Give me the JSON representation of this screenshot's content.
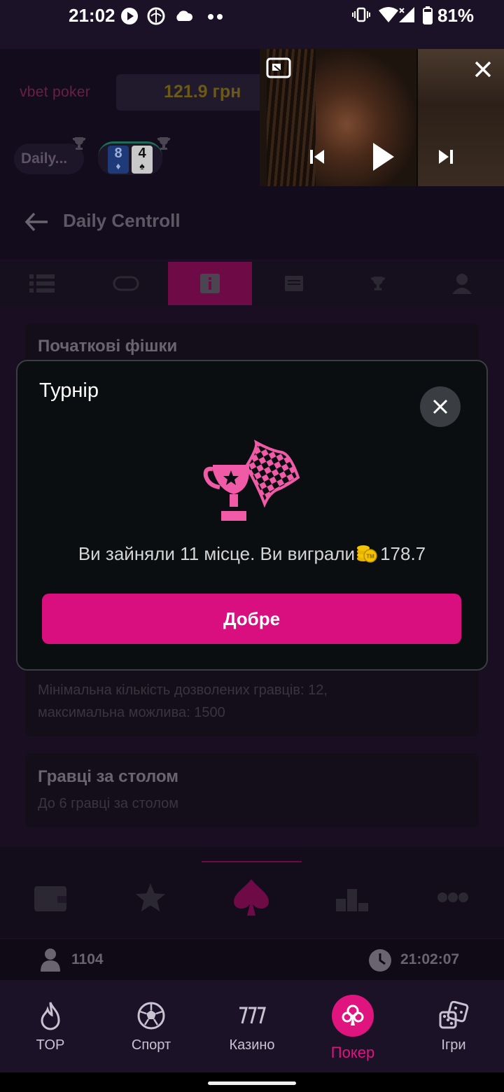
{
  "status_bar": {
    "time": "21:02",
    "battery": "81%",
    "icons": [
      "play-notification-icon",
      "sports-notification-icon",
      "cloud-icon",
      "more-dots-icon",
      "vibrate-icon",
      "wifi-icon",
      "signal-icon",
      "battery-icon"
    ]
  },
  "header": {
    "logo": "vbet poker",
    "balance": "121.9 грн",
    "tournament_chip": "Daily...",
    "cards": [
      {
        "rank": "8",
        "suit": "♦",
        "color": "#1e4a9c"
      },
      {
        "rank": "4",
        "suit": "♠",
        "color": "#111111"
      }
    ]
  },
  "page": {
    "title": "Daily Centroll",
    "tabs": [
      "list-icon",
      "table-icon",
      "info-icon",
      "chat-icon",
      "trophy-icon",
      "person-icon"
    ],
    "active_tab": 2
  },
  "info_sections": [
    {
      "title": "Початкові фішки"
    },
    {
      "title": "",
      "text": "Мінімальна кількість дозволених гравців: 12, максимальна можлива: 1500"
    },
    {
      "title": "Гравці за столом",
      "text": "До 6 гравці за столом"
    }
  ],
  "info_bar": {
    "players": "1104",
    "clock": "21:02:07"
  },
  "dialog": {
    "title": "Турнір",
    "message_prefix": "Ви зайняли 11 місце. Ви виграли",
    "amount": "178.7",
    "ok_label": "Добре"
  },
  "bottom_nav": {
    "items": [
      {
        "label": "TOP",
        "icon": "flame-icon"
      },
      {
        "label": "Спорт",
        "icon": "soccer-ball-icon"
      },
      {
        "label": "Казино",
        "icon": "slots-777-icon"
      },
      {
        "label": "Покер",
        "icon": "club-suit-icon"
      },
      {
        "label": "Ігри",
        "icon": "dice-icon"
      }
    ],
    "active": 3
  },
  "colors": {
    "accent": "#e0147e",
    "dialog_bg": "#0a0e10",
    "nav_bg": "#1c1228"
  }
}
